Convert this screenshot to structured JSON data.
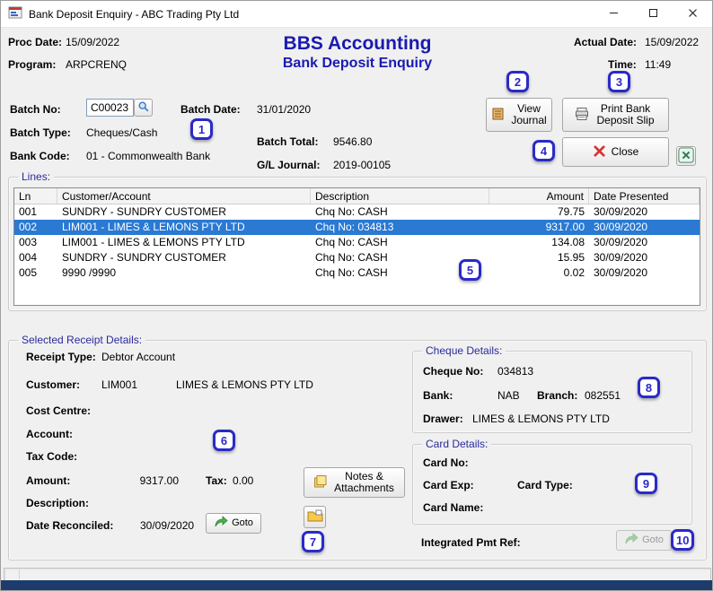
{
  "window": {
    "title": "Bank Deposit Enquiry - ABC Trading Pty Ltd"
  },
  "colors": {
    "heading_navy": "#1a1ab2",
    "group_label_blue": "#2a2a9e",
    "selection_blue": "#2a79d2",
    "annotation_blue": "#2a2ac8",
    "close_red": "#d83434",
    "goto_green": "#49b24e",
    "excel_green": "#2e7d4f",
    "bottom_bar_navy": "#1d3c6b"
  },
  "header": {
    "proc_date_label": "Proc Date:",
    "proc_date": "15/09/2022",
    "program_label": "Program:",
    "program": "ARPCRENQ",
    "app_title": "BBS Accounting",
    "page_title": "Bank Deposit Enquiry",
    "actual_date_label": "Actual Date:",
    "actual_date": "15/09/2022",
    "time_label": "Time:",
    "time": "11:49"
  },
  "batch": {
    "batch_no_label": "Batch No:",
    "batch_no": "C00023",
    "batch_date_label": "Batch Date:",
    "batch_date": "31/01/2020",
    "batch_type_label": "Batch Type:",
    "batch_type": "Cheques/Cash",
    "batch_total_label": "Batch Total:",
    "batch_total": "9546.80",
    "bank_code_label": "Bank Code:",
    "bank_code": "01 - Commonwealth Bank",
    "gl_journal_label": "G/L Journal:",
    "gl_journal": "2019-00105"
  },
  "actions": {
    "view_journal": "View Journal",
    "print_deposit_slip": "Print Bank Deposit Slip",
    "close": "Close"
  },
  "lines": {
    "label": "Lines:",
    "columns": [
      "Ln",
      "Customer/Account",
      "Description",
      "Amount",
      "Date Presented"
    ],
    "rows": [
      {
        "ln": "001",
        "customer": "SUNDRY - SUNDRY CUSTOMER",
        "description": "Chq No: CASH",
        "amount": "79.75",
        "date_presented": "30/09/2020"
      },
      {
        "ln": "002",
        "customer": "LIM001 - LIMES & LEMONS PTY LTD",
        "description": "Chq No: 034813",
        "amount": "9317.00",
        "date_presented": "30/09/2020"
      },
      {
        "ln": "003",
        "customer": "LIM001 - LIMES & LEMONS PTY LTD",
        "description": "Chq No: CASH",
        "amount": "134.08",
        "date_presented": "30/09/2020"
      },
      {
        "ln": "004",
        "customer": "SUNDRY - SUNDRY CUSTOMER",
        "description": "Chq No: CASH",
        "amount": "15.95",
        "date_presented": "30/09/2020"
      },
      {
        "ln": "005",
        "customer": "9990 /9990",
        "description": "Chq No: CASH",
        "amount": "0.02",
        "date_presented": "30/09/2020"
      }
    ],
    "selected_row_index": 1
  },
  "receipt": {
    "label": "Selected Receipt Details:",
    "receipt_type_label": "Receipt Type:",
    "receipt_type": "Debtor Account",
    "customer_label": "Customer:",
    "customer_code": "LIM001",
    "customer_name": "LIMES & LEMONS PTY LTD",
    "cost_centre_label": "Cost Centre:",
    "account_label": "Account:",
    "tax_code_label": "Tax Code:",
    "amount_label": "Amount:",
    "amount": "9317.00",
    "tax_label": "Tax:",
    "tax": "0.00",
    "description_label": "Description:",
    "date_reconciled_label": "Date Reconciled:",
    "date_reconciled": "30/09/2020",
    "goto_label": "Goto",
    "notes_attachments": "Notes & Attachments"
  },
  "cheque": {
    "label": "Cheque Details:",
    "cheque_no_label": "Cheque No:",
    "cheque_no": "034813",
    "bank_label": "Bank:",
    "bank": "NAB",
    "branch_label": "Branch:",
    "branch": "082551",
    "drawer_label": "Drawer:",
    "drawer": "LIMES & LEMONS PTY LTD"
  },
  "card": {
    "label": "Card Details:",
    "card_no_label": "Card No:",
    "card_exp_label": "Card Exp:",
    "card_type_label": "Card Type:",
    "card_name_label": "Card Name:"
  },
  "integrated": {
    "label": "Integrated Pmt Ref:",
    "goto_label": "Goto"
  },
  "annotations": {
    "badges": [
      "1",
      "2",
      "3",
      "4",
      "5",
      "6",
      "7",
      "8",
      "9",
      "10"
    ]
  }
}
